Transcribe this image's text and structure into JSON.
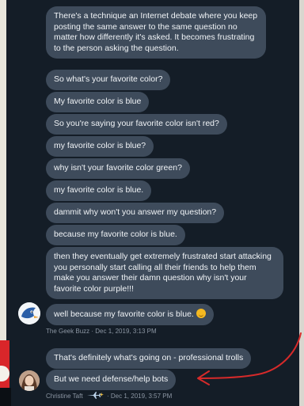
{
  "thread": {
    "messages": [
      {
        "text": "There's a technique an Internet debate where you keep posting the same answer to the same question no matter how differently it's asked. It becomes frustrating to the person asking the question."
      },
      {
        "text": "So what's your favorite color?"
      },
      {
        "text": "My favorite color is blue"
      },
      {
        "text": "So you're saying your favorite color isn't red?"
      },
      {
        "text": "my favorite color is blue?"
      },
      {
        "text": "why isn't your favorite color green?"
      },
      {
        "text": "my favorite color is blue."
      },
      {
        "text": "dammit why won't you answer my question?"
      },
      {
        "text": "because my favorite color is blue."
      },
      {
        "text": "then they eventually get extremely frustrated start attacking you personally start calling all their friends to help them make you answer their damn question why isn't your favorite color purple!!!"
      },
      {
        "text": "well because my favorite color is blue."
      }
    ],
    "sender1_meta": "The Geek Buzz · Dec 1, 2019, 3:13 PM",
    "reply": [
      {
        "text": "That's definitely what's going on - professional trolls"
      },
      {
        "text": "But we need defense/help bots"
      }
    ],
    "sender2_name": "Christine Taft",
    "sender2_date": "· Dec 1, 2019, 3:57 PM"
  },
  "icons": {
    "sender1_avatar": "cartoon-bird-avatar",
    "sender2_avatar": "woman-photo-avatar",
    "smile": "smiling-face-emoji",
    "annotation": "red-hand-drawn-arrow",
    "name_decor": "airplane-and-sparkle-emoji"
  },
  "colors": {
    "background": "#141d27",
    "bubble": "#3e4b5b",
    "annotation": "#d62a2a"
  }
}
